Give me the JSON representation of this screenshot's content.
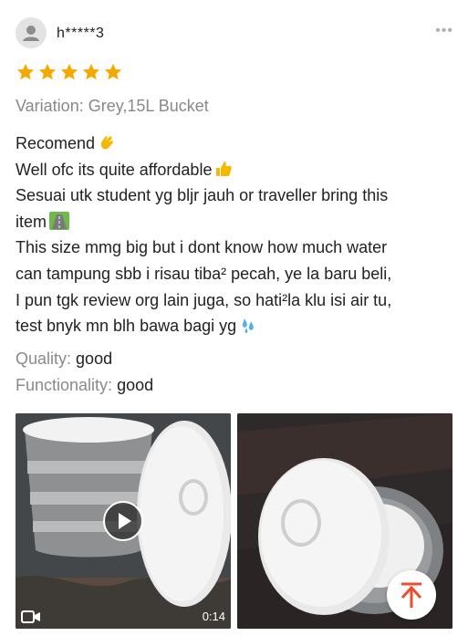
{
  "review": {
    "username": "h*****3",
    "more_icon": "more-dots-icon",
    "rating": 5,
    "variation": "Variation: Grey,15L Bucket",
    "lines": [
      "Recomend",
      "Well ofc its quite affordable",
      "Sesuai utk student yg bljr jauh or traveller bring this",
      "item",
      "This size mmg big but i dont know how much water",
      "can tampung sbb i risau tiba² pecah, ye la baru beli,",
      "I pun tgk review org lain juga, so hati²la klu isi air tu,",
      "test bnyk mn blh bawa bagi yg"
    ],
    "quality_label": "Quality:",
    "quality_value": "good",
    "functionality_label": "Functionality:",
    "functionality_value": "good"
  },
  "media": {
    "video_duration": "0:14",
    "video_icon": "video-camera-icon",
    "play_icon": "play-icon"
  },
  "colors": {
    "star": "#f6a700",
    "accent": "#ee4d2d"
  }
}
